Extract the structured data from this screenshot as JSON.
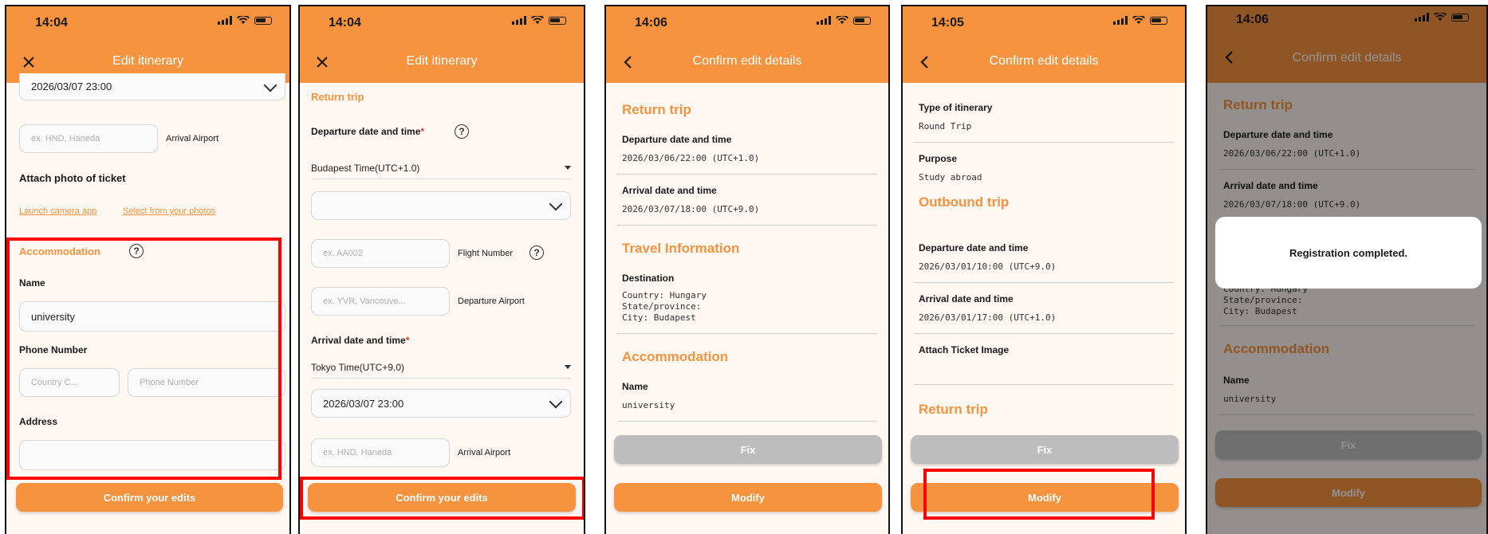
{
  "colors": {
    "accent": "#f7933e",
    "highlight": "#ff0000",
    "gray_button": "#bdbdbd"
  },
  "screens": [
    {
      "status_time": "14:04",
      "title": "Edit itinerary",
      "nav_icon": "close-icon",
      "top_date_value": "2026/03/07 23:00",
      "arrival_airport_placeholder": "ex. HND, Haneda",
      "arrival_airport_label": "Arrival Airport",
      "attach_photo_label": "Attach photo of ticket",
      "launch_camera_link": "Launch camera app",
      "select_photos_link": "Select from your photos",
      "accommodation_title": "Accommodation",
      "name_label": "Name",
      "name_value": "university",
      "phone_label": "Phone Number",
      "country_code_placeholder": "Country C...",
      "phone_placeholder": "Phone Number",
      "address_label": "Address",
      "address_value": "",
      "confirm_button": "Confirm your edits"
    },
    {
      "status_time": "14:04",
      "title": "Edit itinerary",
      "nav_icon": "close-icon",
      "return_trip_title": "Return trip",
      "departure_label": "Departure date and time",
      "required_mark": "*",
      "departure_timezone": "Budapest Time(UTC+1.0)",
      "departure_date_value": "",
      "flight_number_placeholder": "ex. AA002",
      "flight_number_label": "Flight Number",
      "departure_airport_placeholder": "ex. YVR, Vancouve...",
      "departure_airport_label": "Departure Airport",
      "arrival_label": "Arrival date and time",
      "arrival_timezone": "Tokyo Time(UTC+9.0)",
      "arrival_date_value": "2026/03/07 23:00",
      "arrival_airport_placeholder": "ex. HND, Haneda",
      "arrival_airport_label": "Arrival Airport",
      "confirm_button": "Confirm your edits"
    },
    {
      "status_time": "14:06",
      "title": "Confirm edit details",
      "nav_icon": "back-chevron-icon",
      "return_trip_title": "Return trip",
      "departure_label": "Departure date and time",
      "departure_value": "2026/03/06/22:00 (UTC+1.0)",
      "arrival_label": "Arrival date and time",
      "arrival_value": "2026/03/07/18:00 (UTC+9.0)",
      "travel_info_title": "Travel Information",
      "destination_label": "Destination",
      "country_line": "Country: Hungary",
      "state_line": "State/province:",
      "city_line": "City: Budapest",
      "accommodation_title": "Accommodation",
      "name_label": "Name",
      "name_value": "university",
      "fix_button": "Fix",
      "modify_button": "Modify"
    },
    {
      "status_time": "14:05",
      "title": "Confirm edit details",
      "nav_icon": "back-chevron-icon",
      "type_label": "Type of itinerary",
      "type_value": "Round Trip",
      "purpose_label": "Purpose",
      "purpose_value": "Study abroad",
      "outbound_title": "Outbound trip",
      "departure_label": "Departure date and time",
      "departure_value": "2026/03/01/10:00 (UTC+9.0)",
      "arrival_label": "Arrival date and time",
      "arrival_value": "2026/03/01/17:00 (UTC+1.0)",
      "attach_label": "Attach Ticket Image",
      "return_trip_title": "Return trip",
      "fix_button": "Fix",
      "modify_button": "Modify"
    },
    {
      "status_time": "14:06",
      "title": "Confirm edit details",
      "nav_icon": "back-chevron-icon",
      "return_trip_title": "Return trip",
      "departure_label": "Departure date and time",
      "departure_value": "2026/03/06/22:00 (UTC+1.0)",
      "arrival_label": "Arrival date and time",
      "arrival_value": "2026/03/07/18:00 (UTC+9.0)",
      "country_line": "Country: Hungary",
      "state_line": "State/province:",
      "city_line": "City: Budapest",
      "accommodation_title": "Accommodation",
      "name_label": "Name",
      "name_value": "university",
      "modal_message": "Registration completed.",
      "fix_button": "Fix",
      "modify_button": "Modify"
    }
  ]
}
